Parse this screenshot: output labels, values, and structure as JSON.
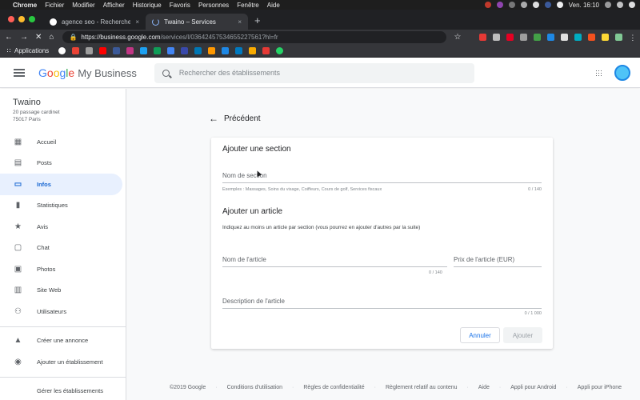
{
  "mac_menu": {
    "app": "Chrome",
    "items": [
      "Fichier",
      "Modifier",
      "Afficher",
      "Historique",
      "Favoris",
      "Personnes",
      "Fenêtre",
      "Aide"
    ],
    "clock": "Ven. 16:10"
  },
  "browser": {
    "tabs": [
      {
        "title": "agence seo - Recherche Google",
        "close": "×"
      },
      {
        "title": "Twaino – Services",
        "close": "×"
      }
    ],
    "new_tab": "+",
    "url_host": "https://business.google.com",
    "url_path": "/services/l/03642457534655227561?hl=fr",
    "bookmarks_label": "Applications"
  },
  "header": {
    "logo_google": "Google",
    "logo_product": "My Business",
    "search_placeholder": "Rechercher des établissements"
  },
  "sidebar": {
    "business_name": "Twaino",
    "address_line1": "20 passage cardinet",
    "address_line2": "75017 Paris",
    "items": [
      {
        "label": "Accueil",
        "icon": "dashboard-icon"
      },
      {
        "label": "Posts",
        "icon": "posts-icon"
      },
      {
        "label": "Infos",
        "icon": "store-icon",
        "active": true
      },
      {
        "label": "Statistiques",
        "icon": "bar-chart-icon"
      },
      {
        "label": "Avis",
        "icon": "star-icon"
      },
      {
        "label": "Chat",
        "icon": "chat-icon"
      },
      {
        "label": "Photos",
        "icon": "photo-icon"
      },
      {
        "label": "Site Web",
        "icon": "website-icon"
      },
      {
        "label": "Utilisateurs",
        "icon": "add-user-icon"
      }
    ],
    "secondary_items": [
      {
        "label": "Créer une annonce",
        "icon": "ads-icon"
      },
      {
        "label": "Ajouter un établissement",
        "icon": "location-pin-icon"
      }
    ],
    "manage_label": "Gérer les établissements"
  },
  "main": {
    "back_label": "Précédent",
    "section_title": "Ajouter une section",
    "section_name_placeholder": "Nom de section",
    "section_hint": "Exemples : Massages, Soins du visage, Coiffeurs, Cours de golf, Services fiscaux",
    "section_counter": "0 / 140",
    "article_title": "Ajouter un article",
    "article_instructions": "Indiquez au moins un article par section (vous pourrez en ajouter d'autres par la suite)",
    "article_name_placeholder": "Nom de l'article",
    "article_name_counter": "0 / 140",
    "article_price_placeholder": "Prix de l'article (EUR)",
    "article_desc_placeholder": "Description de l'article",
    "article_desc_counter": "0 / 1 000",
    "cancel_label": "Annuler",
    "add_label": "Ajouter"
  },
  "footer": {
    "links": [
      "©2019 Google",
      "Conditions d'utilisation",
      "Règles de confidentialité",
      "Règlement relatif au contenu",
      "Aide",
      "Appli pour Android",
      "Appli pour iPhone"
    ]
  },
  "colors": {
    "accent": "#1a73e8",
    "active_bg": "#e8f0fe",
    "chrome_dark": "#202124"
  }
}
